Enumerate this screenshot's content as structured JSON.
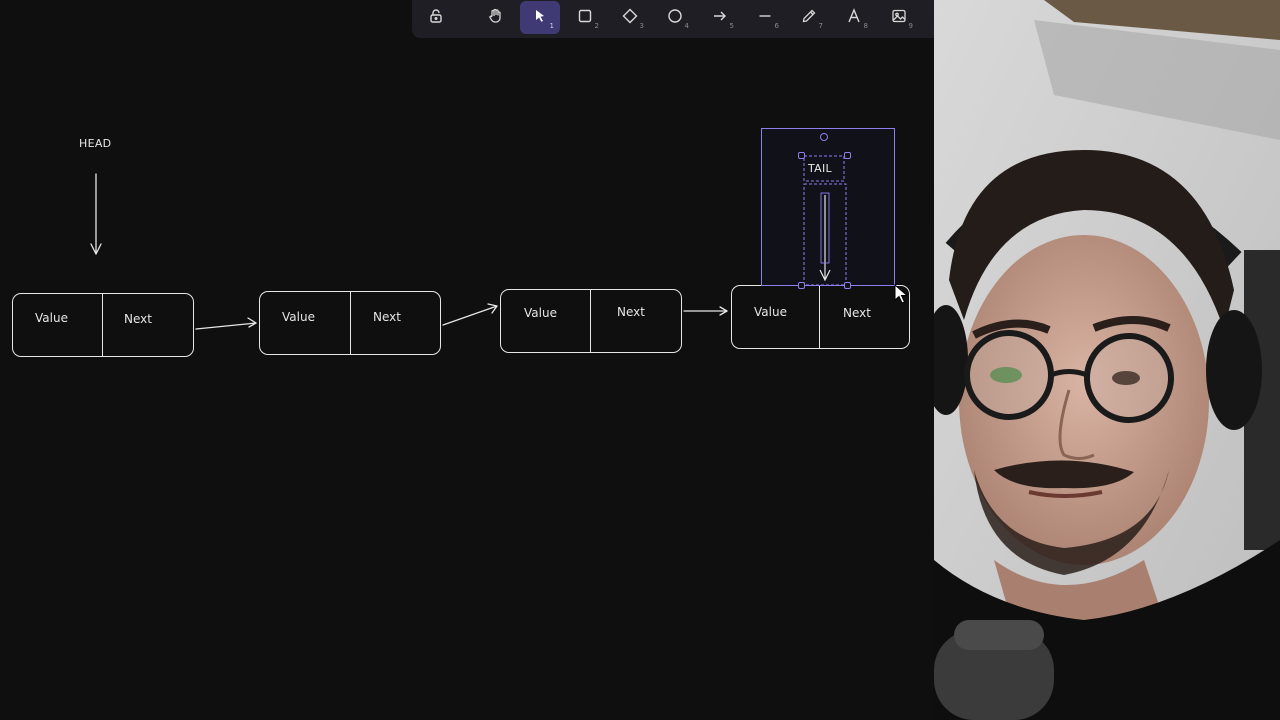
{
  "toolbar": {
    "tools": [
      {
        "name": "lock",
        "key": ""
      },
      {
        "name": "hand",
        "key": ""
      },
      {
        "name": "selection",
        "key": "1"
      },
      {
        "name": "rectangle",
        "key": "2"
      },
      {
        "name": "diamond",
        "key": "3"
      },
      {
        "name": "ellipse",
        "key": "4"
      },
      {
        "name": "arrow",
        "key": "5"
      },
      {
        "name": "line",
        "key": "6"
      },
      {
        "name": "draw",
        "key": "7"
      },
      {
        "name": "text",
        "key": "8"
      },
      {
        "name": "image",
        "key": "9"
      }
    ],
    "active": "selection"
  },
  "diagram": {
    "head_label": "HEAD",
    "tail_label": "TAIL",
    "nodes": [
      {
        "value": "Value",
        "next": "Next"
      },
      {
        "value": "Value",
        "next": "Next"
      },
      {
        "value": "Value",
        "next": "Next"
      },
      {
        "value": "Value",
        "next": "Next"
      }
    ]
  },
  "colors": {
    "canvas_bg": "#0f0f0f",
    "stroke": "#e6e6e6",
    "selection": "#8d7ff0",
    "toolbar_bg": "#1e1e24",
    "active_tool": "#3f3a73"
  }
}
